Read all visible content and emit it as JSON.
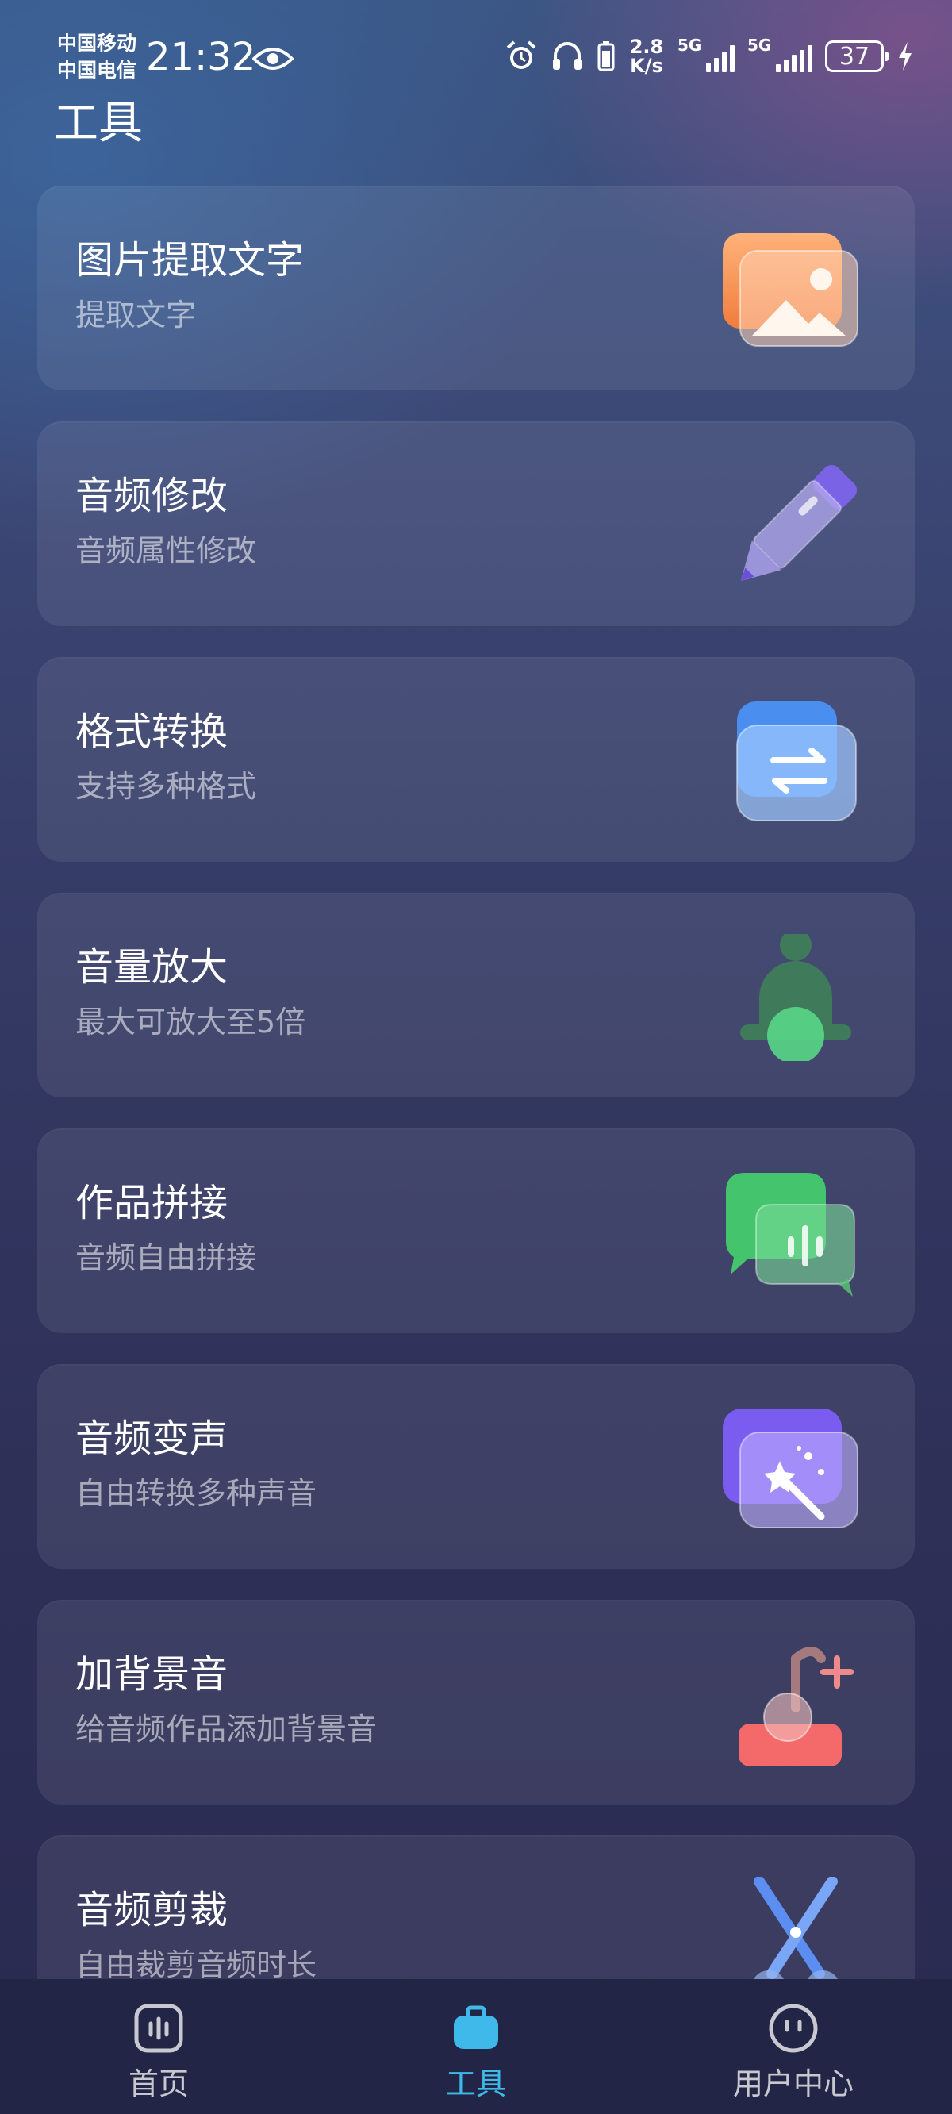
{
  "status_bar": {
    "carrier_1": "中国移动",
    "carrier_2": "中国电信",
    "time": "21:32",
    "net_speed_value": "2.8",
    "net_speed_unit": "K/s",
    "sim1_type": "5G",
    "sim2_type": "5G",
    "battery": "37",
    "icons": [
      "eye-icon",
      "alarm-icon",
      "headphones-icon",
      "battery-saver-icon",
      "signal-icon",
      "charging-icon"
    ]
  },
  "page": {
    "title": "工具"
  },
  "tools": [
    {
      "title": "图片提取文字",
      "subtitle": "提取文字",
      "icon": "image-icon"
    },
    {
      "title": "音频修改",
      "subtitle": "音频属性修改",
      "icon": "pencil-icon"
    },
    {
      "title": "格式转换",
      "subtitle": "支持多种格式",
      "icon": "swap-icon"
    },
    {
      "title": "音量放大",
      "subtitle": "最大可放大至5倍",
      "icon": "bell-icon"
    },
    {
      "title": "作品拼接",
      "subtitle": "音频自由拼接",
      "icon": "chat-bubbles-icon"
    },
    {
      "title": "音频变声",
      "subtitle": "自由转换多种声音",
      "icon": "magic-wand-icon"
    },
    {
      "title": "加背景音",
      "subtitle": "给音频作品添加背景音",
      "icon": "music-note-add-icon"
    },
    {
      "title": "音频剪裁",
      "subtitle": "自由裁剪音频时长",
      "icon": "scissors-icon"
    }
  ],
  "bottom_nav": [
    {
      "label": "首页",
      "icon": "waveform-icon",
      "active": false
    },
    {
      "label": "工具",
      "icon": "briefcase-icon",
      "active": true
    },
    {
      "label": "用户中心",
      "icon": "user-face-icon",
      "active": false
    }
  ],
  "colors": {
    "accent": "#3fb8ea",
    "nav_background": "#222545",
    "card_background": "rgba(255,255,255,0.08)",
    "subtitle_text": "rgba(255,255,255,0.55)"
  }
}
